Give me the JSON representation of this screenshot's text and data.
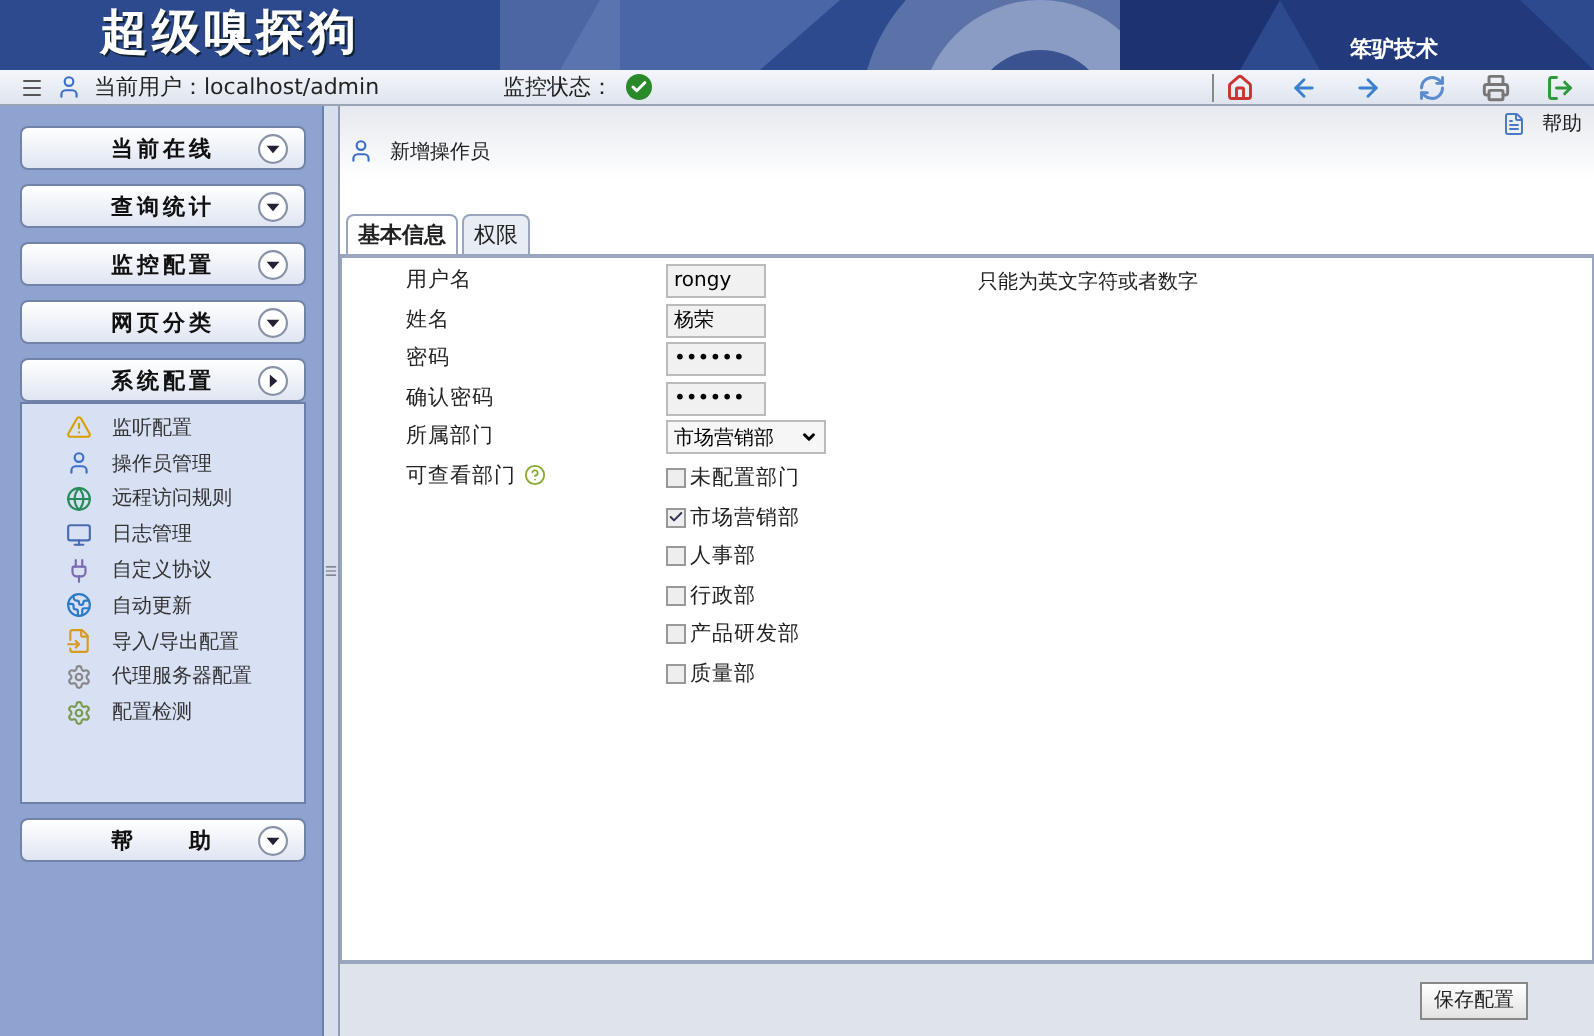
{
  "header": {
    "title": "超级嗅探狗",
    "company": "笨驴技术"
  },
  "toolbar": {
    "user_label": "当前用户：",
    "user": "localhost/admin",
    "status_label": "监控状态：",
    "status_ok": true
  },
  "sidebar": {
    "sections": [
      {
        "title": "当前在线",
        "expanded": false
      },
      {
        "title": "查询统计",
        "expanded": false
      },
      {
        "title": "监控配置",
        "expanded": false
      },
      {
        "title": "网页分类",
        "expanded": false
      },
      {
        "title": "系统配置",
        "expanded": true,
        "items": [
          "监听配置",
          "操作员管理",
          "远程访问规则",
          "日志管理",
          "自定义协议",
          "自动更新",
          "导入/导出配置",
          "代理服务器配置",
          "配置检测"
        ]
      },
      {
        "title": "帮　　助",
        "expanded": false
      }
    ]
  },
  "content": {
    "title": "新增操作员",
    "help": "帮助",
    "tabs": [
      {
        "label": "基本信息",
        "selected": true
      },
      {
        "label": "权限",
        "selected": false
      }
    ],
    "fields": [
      {
        "kind": "text",
        "label": "用户名",
        "value": "rongy",
        "hint": "只能为英文字符或者数字"
      },
      {
        "kind": "text",
        "label": "姓名",
        "value": "杨荣"
      },
      {
        "kind": "password",
        "label": "密码",
        "value": "••••••"
      },
      {
        "kind": "password",
        "label": "确认密码",
        "value": "••••••"
      },
      {
        "kind": "select",
        "label": "所属部门",
        "value": "市场营销部"
      },
      {
        "kind": "checkboxes",
        "label": "可查看部门",
        "help_icon": true,
        "options": [
          {
            "label": "未配置部门",
            "checked": false
          },
          {
            "label": "市场营销部",
            "checked": true
          },
          {
            "label": "人事部",
            "checked": false
          },
          {
            "label": "行政部",
            "checked": false
          },
          {
            "label": "产品研发部",
            "checked": false
          },
          {
            "label": "质量部",
            "checked": false
          }
        ]
      }
    ],
    "save_button": "保存配置"
  }
}
